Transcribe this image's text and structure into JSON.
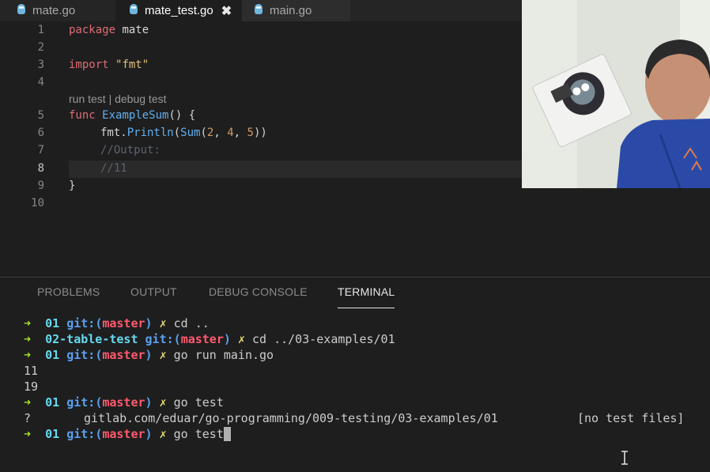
{
  "tabs": [
    {
      "label": "mate.go",
      "active": false
    },
    {
      "label": "mate_test.go",
      "active": true,
      "close": "✖"
    },
    {
      "label": "main.go",
      "active": false
    }
  ],
  "editor": {
    "lines": {
      "l1": {
        "num": "1",
        "kw": "package",
        "rest": " mate"
      },
      "l2": {
        "num": "2"
      },
      "l3": {
        "num": "3",
        "kw": "import",
        "str": "\"fmt\""
      },
      "l4": {
        "num": "4"
      },
      "codelens": "run test | debug test",
      "l5": {
        "num": "5",
        "kw": "func",
        "fn": "ExampleSum",
        "rest": "() {"
      },
      "l6": {
        "num": "6",
        "a": "fmt.",
        "b": "Println",
        "c": "(",
        "d": "Sum",
        "e": "(",
        "n1": "2",
        "s1": ", ",
        "n2": "4",
        "s2": ", ",
        "n3": "5",
        "f": "))"
      },
      "l7": {
        "num": "7",
        "cmt": "//Output:"
      },
      "l8": {
        "num": "8",
        "cmt": "//11"
      },
      "l9": {
        "num": "9",
        "rest": "}"
      },
      "l10": {
        "num": "10"
      }
    }
  },
  "panel": {
    "tabs": [
      "PROBLEMS",
      "OUTPUT",
      "DEBUG CONSOLE",
      "TERMINAL"
    ],
    "active_tab": "TERMINAL"
  },
  "terminal": {
    "arrow": "➜",
    "git": "git:",
    "branch_open": "(",
    "branch": "master",
    "branch_close": ")",
    "x": "✗",
    "lines": [
      {
        "dir": "01",
        "cmd": "cd .."
      },
      {
        "dir": "02-table-test",
        "cmd": "cd ../03-examples/01"
      },
      {
        "dir": "01",
        "cmd": "go run main.go"
      },
      {
        "out": "11"
      },
      {
        "out": "19"
      },
      {
        "dir": "01",
        "cmd": "go test"
      },
      {
        "q": "?",
        "pkg": "gitlab.com/eduar/go-programming/009-testing/03-examples/01",
        "status": "[no test files]"
      },
      {
        "dir": "01",
        "cmd": "go test"
      }
    ]
  },
  "colors": {
    "editor_bg": "#1e1e1e",
    "keyword": "#e06c75",
    "function": "#61afef",
    "string": "#e5c07b",
    "number": "#d19a66",
    "comment": "#5c6370",
    "prompt_arrow": "#a6e22e",
    "branch": "#ff5a6e"
  }
}
